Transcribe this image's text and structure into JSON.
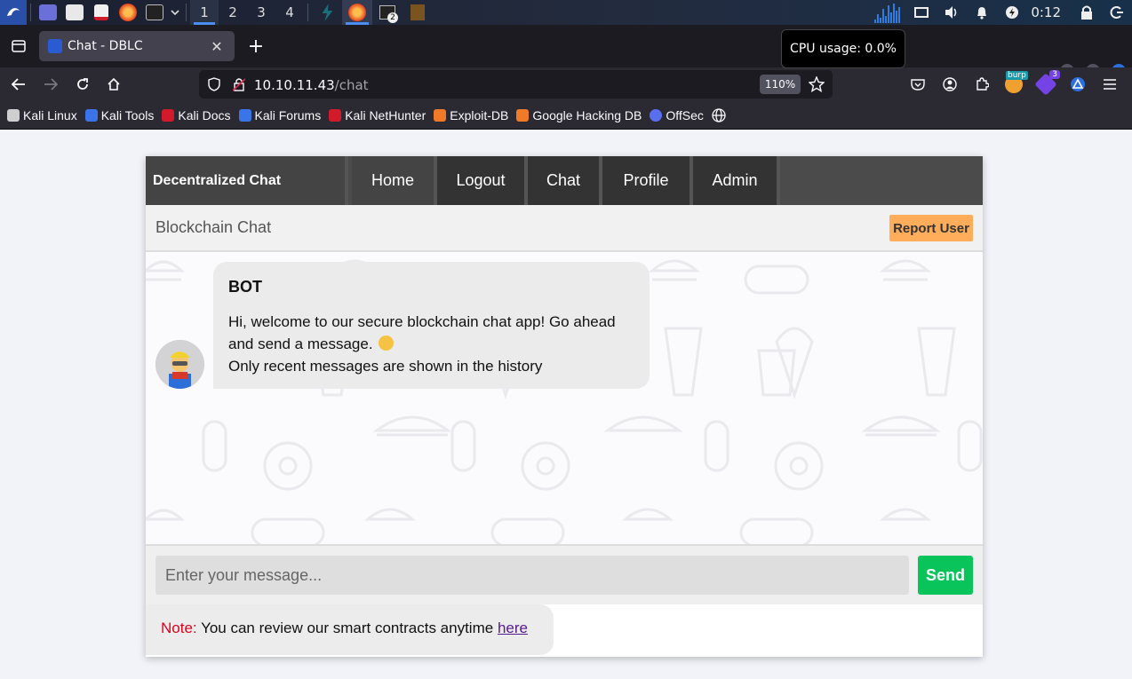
{
  "panel": {
    "workspaces": [
      "1",
      "2",
      "3",
      "4"
    ],
    "terminal_badge": "2",
    "clock": "0:12"
  },
  "browser": {
    "tab_title": "Chat - DBLC",
    "cpu_tooltip": "CPU usage: 0.0%",
    "url_host": "10.10.11.43",
    "url_path": "/chat",
    "zoom": "110%",
    "extension_badge": "3",
    "burp_label": "burp"
  },
  "bookmarks": [
    {
      "label": "Kali Linux",
      "color": "#e8e8e8"
    },
    {
      "label": "Kali Tools",
      "color": "#3b74e8"
    },
    {
      "label": "Kali Docs",
      "color": "#d11a2a"
    },
    {
      "label": "Kali Forums",
      "color": "#3b74e8"
    },
    {
      "label": "Kali NetHunter",
      "color": "#d11a2a"
    },
    {
      "label": "Exploit-DB",
      "color": "#f07a28"
    },
    {
      "label": "Google Hacking DB",
      "color": "#f07a28"
    },
    {
      "label": "OffSec",
      "color": "#5a6ff0"
    }
  ],
  "app": {
    "brand": "Decentralized Chat",
    "nav": [
      "Home",
      "Logout",
      "Chat",
      "Profile",
      "Admin"
    ],
    "subtitle": "Blockchain Chat",
    "report_label": "Report User",
    "message": {
      "sender": "BOT",
      "line1": "Hi, welcome to our secure blockchain chat app! Go ahead and send a message.",
      "line2": "Only recent messages are shown in the history"
    },
    "input_placeholder": "Enter your message...",
    "send_label": "Send",
    "note_label": "Note:",
    "note_text": "You can review our smart contracts anytime",
    "note_link": "here"
  },
  "colors": {
    "brand_bg": "#444444",
    "nav_bg": "#333333",
    "report_btn": "#ffad5a",
    "send_btn": "#08c45a",
    "note_label": "#e0001b"
  }
}
